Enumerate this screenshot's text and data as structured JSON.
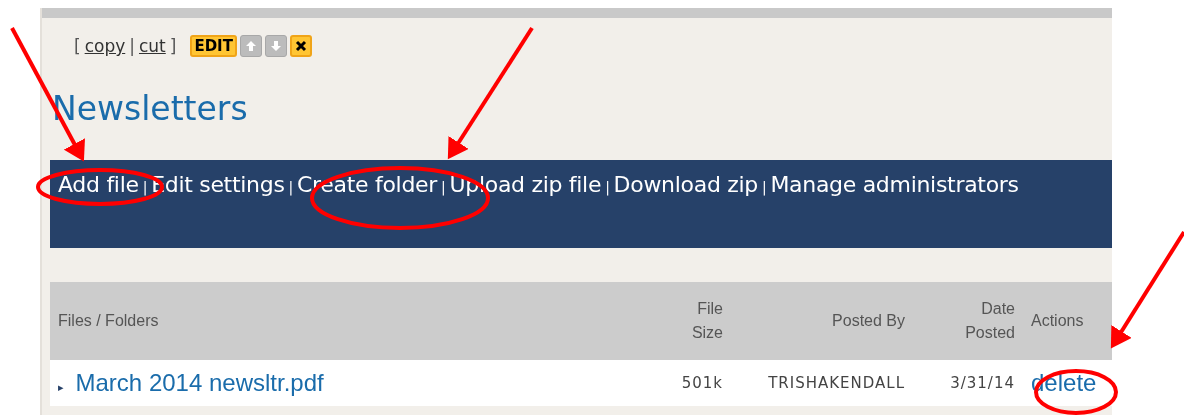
{
  "toolbar": {
    "bracket_open": "[",
    "links": [
      "copy",
      "cut"
    ],
    "separator": "|",
    "bracket_close": "]",
    "edit_button": "EDIT",
    "buttons": [
      {
        "kind": "up",
        "disabled": true
      },
      {
        "kind": "down",
        "disabled": true
      },
      {
        "kind": "delete",
        "disabled": false
      }
    ]
  },
  "title": "Newsletters",
  "actions": [
    "Add file",
    "Edit settings",
    "Create folder",
    "Upload zip file",
    "Download zip",
    "Manage administrators"
  ],
  "actions_separator": "|",
  "table": {
    "columns": [
      {
        "label": "Files / Folders"
      },
      {
        "label": "File Size"
      },
      {
        "label": "Posted By"
      },
      {
        "label": "Date Posted"
      },
      {
        "label": "Actions"
      }
    ],
    "rows": [
      {
        "bullet": "▸",
        "name": "March 2014 newsltr.pdf",
        "size": "501k",
        "posted_by": "TRISHAKENDALL",
        "date": "3/31/14",
        "action": "delete"
      }
    ]
  }
}
